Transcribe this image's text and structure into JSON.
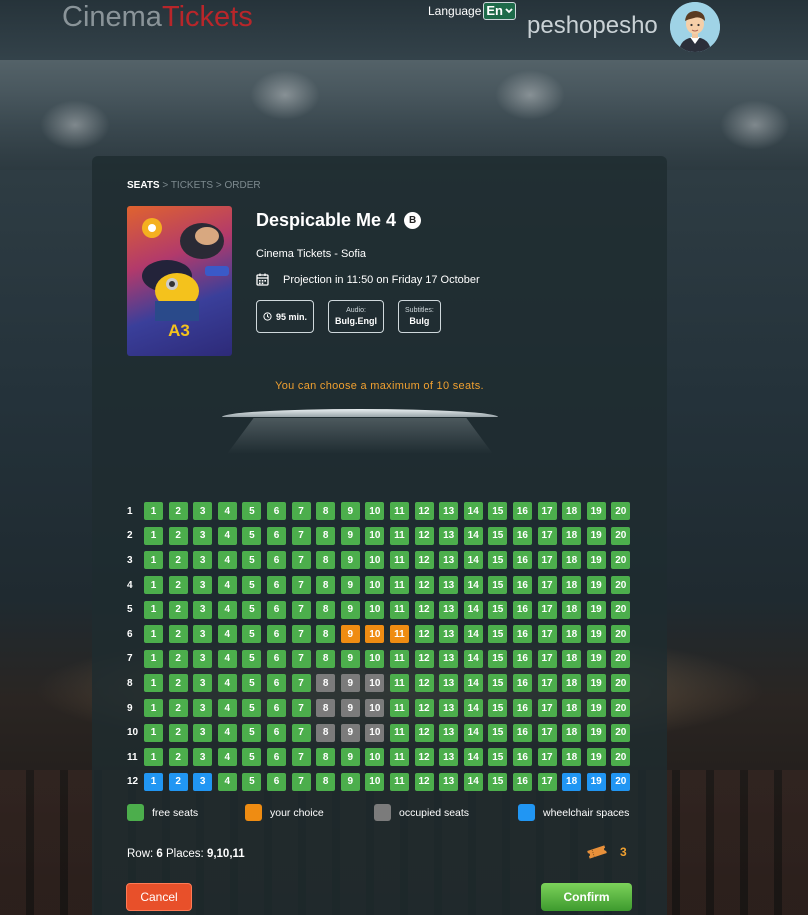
{
  "header": {
    "logo_part1": "Cinema",
    "logo_part2": "Tickets",
    "language_label": "Language",
    "language_value": "En",
    "username": "peshopesho"
  },
  "breadcrumb": {
    "step1": "SEATS",
    "sep1": " > ",
    "step2": "TICKETS",
    "sep2": " > ",
    "step3": "ORDER"
  },
  "movie": {
    "title": "Despicable Me 4",
    "rating": "B",
    "cinema": "Cinema Tickets - Sofia",
    "projection": "Projection in 11:50 on Friday 17 October",
    "duration": "95 min.",
    "audio_label": "Audio:",
    "audio_value": "Bulg.Engl",
    "subtitles_label": "Subtitles:",
    "subtitles_value": "Bulg"
  },
  "limit_message": "You can choose a maximum of 10 seats.",
  "seating": {
    "rows": 12,
    "seats_per_row": 20,
    "choice": [
      [
        6,
        9
      ],
      [
        6,
        10
      ],
      [
        6,
        11
      ]
    ],
    "occupied": [
      [
        8,
        8
      ],
      [
        8,
        9
      ],
      [
        8,
        10
      ],
      [
        9,
        8
      ],
      [
        9,
        9
      ],
      [
        9,
        10
      ],
      [
        10,
        8
      ],
      [
        10,
        9
      ],
      [
        10,
        10
      ]
    ],
    "wheelchair": [
      [
        12,
        1
      ],
      [
        12,
        2
      ],
      [
        12,
        3
      ],
      [
        12,
        18
      ],
      [
        12,
        19
      ],
      [
        12,
        20
      ]
    ]
  },
  "legend": {
    "free": "free seats",
    "choice": "your choice",
    "occupied": "occupied seats",
    "wheelchair": "wheelchair spaces"
  },
  "summary": {
    "row_label": "Row:",
    "row_value": "6",
    "places_label": "Places:",
    "places_value": "9,10,11"
  },
  "ticket_count": "3",
  "buttons": {
    "cancel": "Cancel",
    "confirm": "Confirm"
  },
  "colors": {
    "free": "#4cae4c",
    "choice": "#ef8c12",
    "occupied": "#7b7b7b",
    "wheelchair": "#2196f3"
  }
}
